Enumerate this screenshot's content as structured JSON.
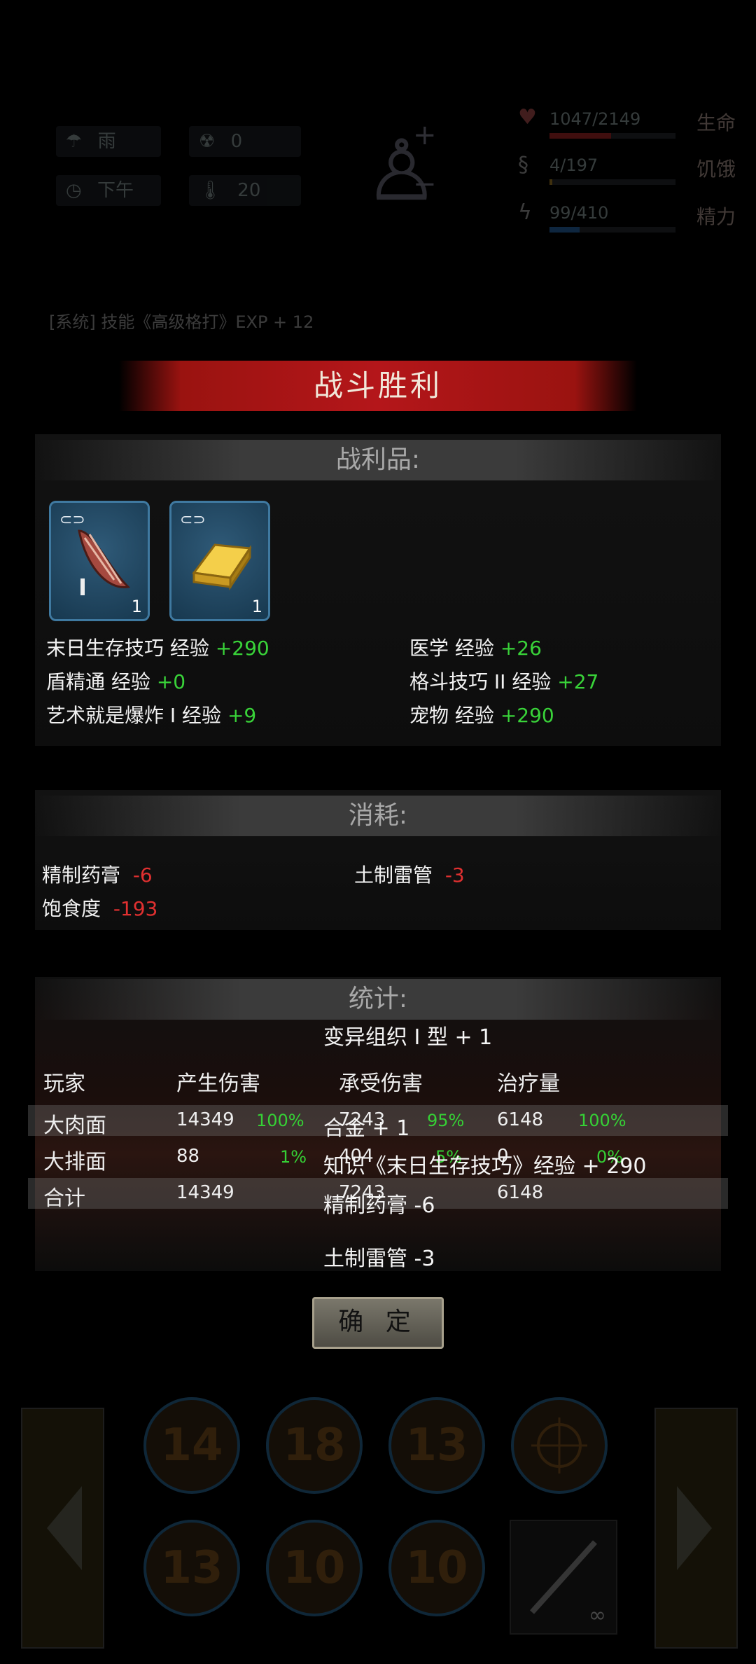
{
  "hud": {
    "weather": "雨",
    "radiation": "0",
    "time_of_day": "下午",
    "temperature": "20",
    "health_value": "1047/2149",
    "health_label": "生命",
    "hunger_value": "4/197",
    "hunger_label": "饥饿",
    "energy_value": "99/410",
    "energy_label": "精力",
    "log_text": "[系统] 技能《高级格打》EXP + 12"
  },
  "title": "战斗胜利",
  "loot": {
    "header": "战利品:",
    "items": [
      {
        "name": "muscle-tissue",
        "qty": "1"
      },
      {
        "name": "gold-bar",
        "qty": "1"
      }
    ],
    "exp_left": [
      {
        "label": "末日生存技巧 经验",
        "value": "+290"
      },
      {
        "label": "盾精通 经验",
        "value": "+0"
      },
      {
        "label": "艺术就是爆炸 I  经验",
        "value": "+9"
      }
    ],
    "exp_right": [
      {
        "label": "医学 经验",
        "value": "+26"
      },
      {
        "label": "格斗技巧 II 经验",
        "value": "+27"
      },
      {
        "label": "宠物 经验",
        "value": "+290"
      }
    ]
  },
  "consume": {
    "header": "消耗:",
    "items": [
      {
        "label": "精制药膏",
        "value": "-6"
      },
      {
        "label": "土制雷管",
        "value": "-3"
      },
      {
        "label": "饱食度",
        "value": "-193"
      }
    ]
  },
  "stats": {
    "header": "统计:",
    "columns": [
      "玩家",
      "产生伤害",
      "承受伤害",
      "治疗量"
    ],
    "rows": [
      {
        "name": "大肉面",
        "damage": "14349",
        "damage_pct": "100%",
        "taken": "7243",
        "taken_pct": "95%",
        "heal": "6148",
        "heal_pct": "100%"
      },
      {
        "name": "大排面",
        "damage": "88",
        "damage_pct": "1%",
        "taken": "404",
        "taken_pct": "5%",
        "heal": "0",
        "heal_pct": "0%"
      },
      {
        "name": "合计",
        "damage": "14349",
        "damage_pct": "",
        "taken": "7243",
        "taken_pct": "",
        "heal": "6148",
        "heal_pct": ""
      }
    ]
  },
  "overlay_messages": [
    "变异组织 I 型 + 1",
    "合金 + 1",
    "知识《末日生存技巧》经验 + 290",
    "精制药膏 -6",
    "土制雷管 -3"
  ],
  "confirm_label": "确 定",
  "skills_row1": [
    "14",
    "18",
    "13",
    ""
  ],
  "skills_row2": [
    "13",
    "10",
    "10"
  ],
  "infinity": "∞"
}
